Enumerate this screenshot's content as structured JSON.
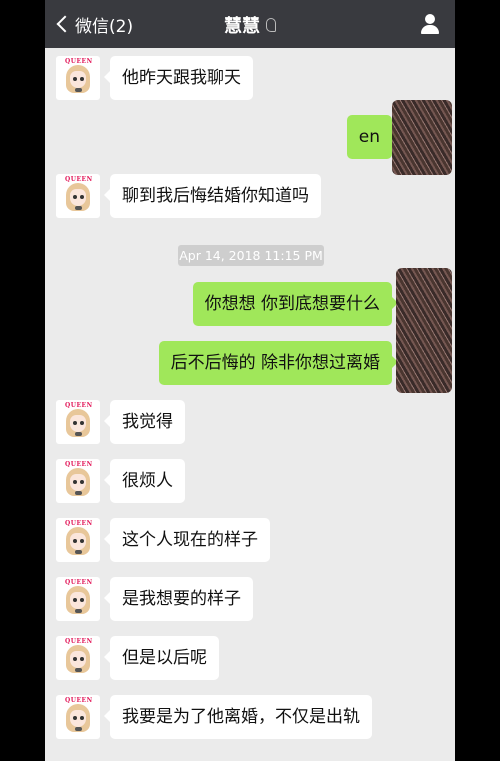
{
  "navbar": {
    "back_label": "微信(2)",
    "title": "慧慧"
  },
  "timestamp": "Apr 14, 2018 11:15 PM",
  "messages": [
    {
      "side": "in",
      "text": "他昨天跟我聊天"
    },
    {
      "side": "out",
      "text": "en"
    },
    {
      "side": "in",
      "text": "聊到我后悔结婚你知道吗"
    },
    {
      "side": "out",
      "text": "你想想 你到底想要什么"
    },
    {
      "side": "out",
      "text": "后不后悔的 除非你想过离婚"
    },
    {
      "side": "in",
      "text": "我觉得"
    },
    {
      "side": "in",
      "text": "很烦人"
    },
    {
      "side": "in",
      "text": "这个人现在的样子"
    },
    {
      "side": "in",
      "text": "是我想要的样子"
    },
    {
      "side": "in",
      "text": "但是以后呢"
    },
    {
      "side": "in",
      "text": "我要是为了他离婚，不仅是出轨"
    }
  ],
  "avatar_tag": "QUEEN",
  "colors": {
    "navbar": "#393a3f",
    "chat_background": "#ebebeb",
    "incoming_bubble": "#ffffff",
    "outgoing_bubble": "#a0e75a"
  },
  "icons": {
    "back": "chevron-left-icon",
    "earpiece": "ear-icon",
    "profile": "person-icon"
  }
}
